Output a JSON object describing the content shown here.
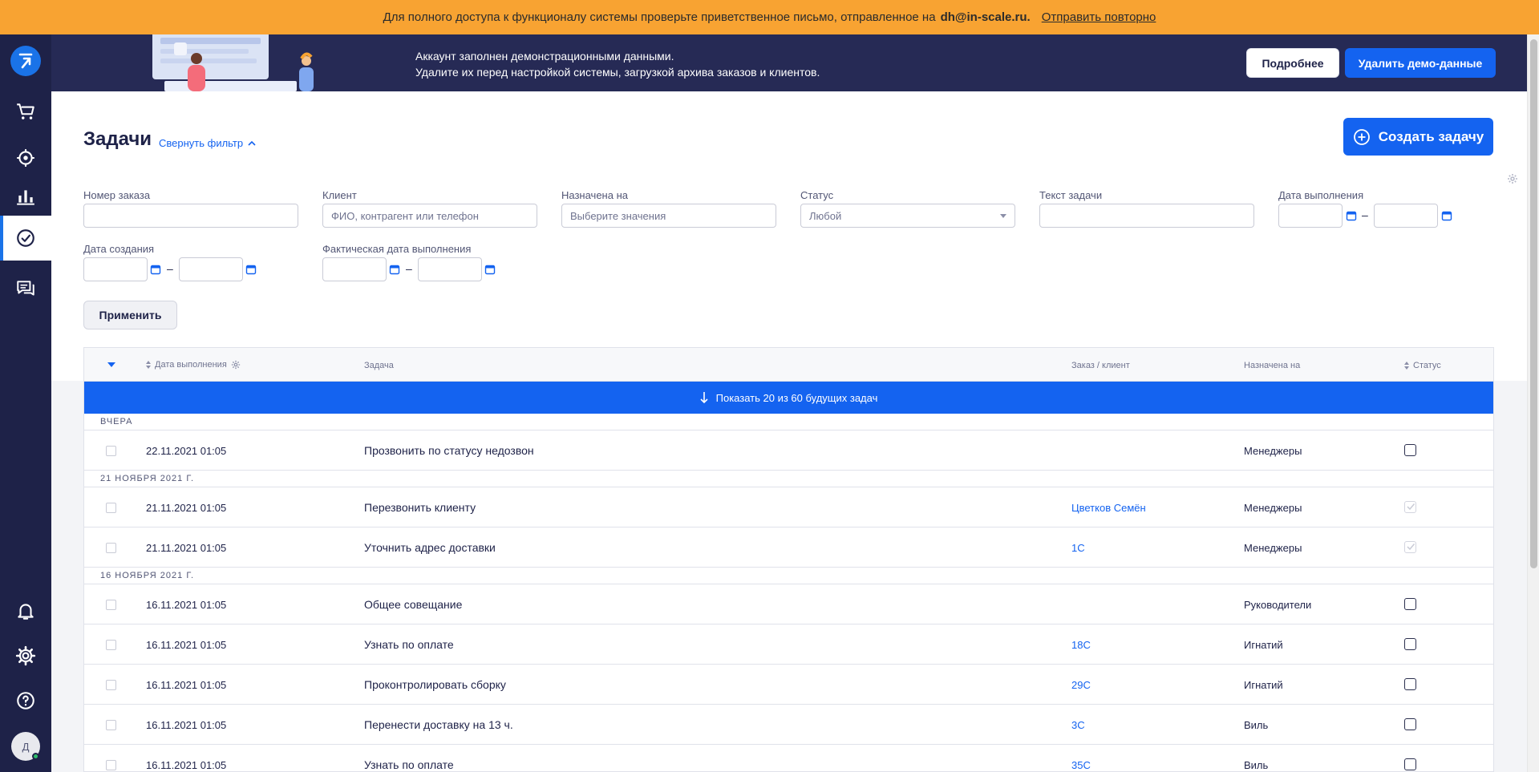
{
  "notice": {
    "text": "Для полного доступа к функционалу системы проверьте приветственное письмо, отправленное на",
    "email": "dh@in-scale.ru.",
    "resend": "Отправить повторно"
  },
  "sidebar": {
    "avatar_initial": "Д",
    "items": [
      "cart",
      "location",
      "analytics",
      "tasks",
      "chats",
      "notifications",
      "settings",
      "help"
    ]
  },
  "demo": {
    "line1": "Аккаунт заполнен демонстрационными данными.",
    "line2": "Удалите их перед настройкой системы, загрузкой архива заказов и клиентов.",
    "more_label": "Подробнее",
    "delete_label": "Удалить демо-данные"
  },
  "page": {
    "title": "Задачи",
    "collapse_filter": "Свернуть фильтр",
    "create_label": "Создать задачу"
  },
  "filters": {
    "order_number": {
      "label": "Номер заказа",
      "value": ""
    },
    "client": {
      "label": "Клиент",
      "placeholder": "ФИО, контрагент или телефон"
    },
    "assigned": {
      "label": "Назначена на",
      "placeholder": "Выберите значения"
    },
    "status": {
      "label": "Статус",
      "value": "Любой"
    },
    "task_text": {
      "label": "Текст задачи",
      "value": ""
    },
    "due_date": {
      "label": "Дата выполнения"
    },
    "created_date": {
      "label": "Дата создания"
    },
    "actual_date": {
      "label": "Фактическая дата выполнения"
    },
    "dash": "–",
    "apply_label": "Применить"
  },
  "table": {
    "headers": {
      "due_date": "Дата выполнения",
      "task": "Задача",
      "order_client": "Заказ / клиент",
      "assigned": "Назначена на",
      "status": "Статус"
    },
    "show_more": "Показать 20 из 60 будущих задач",
    "groups": [
      {
        "label": "ВЧЕРА"
      },
      {
        "label": "21 НОЯБРЯ 2021 Г."
      },
      {
        "label": "16 НОЯБРЯ 2021 Г."
      }
    ],
    "rows": [
      {
        "date": "22.11.2021 01:05",
        "task": "Прозвонить по статусу недозвон",
        "order": "",
        "assigned": "Менеджеры",
        "done": false
      },
      {
        "date": "21.11.2021 01:05",
        "task": "Перезвонить клиенту",
        "order": "Цветков Семён",
        "assigned": "Менеджеры",
        "done": true
      },
      {
        "date": "21.11.2021 01:05",
        "task": "Уточнить адрес доставки",
        "order": "1C",
        "assigned": "Менеджеры",
        "done": true
      },
      {
        "date": "16.11.2021 01:05",
        "task": "Общее совещание",
        "order": "",
        "assigned": "Руководители",
        "done": false
      },
      {
        "date": "16.11.2021 01:05",
        "task": "Узнать по оплате",
        "order": "18C",
        "assigned": "Игнатий",
        "done": false
      },
      {
        "date": "16.11.2021 01:05",
        "task": "Проконтролировать сборку",
        "order": "29C",
        "assigned": "Игнатий",
        "done": false
      },
      {
        "date": "16.11.2021 01:05",
        "task": "Перенести доставку на 13 ч.",
        "order": "3C",
        "assigned": "Виль",
        "done": false
      },
      {
        "date": "16.11.2021 01:05",
        "task": "Узнать по оплате",
        "order": "35C",
        "assigned": "Виль",
        "done": false
      }
    ]
  },
  "colors": {
    "accent": "#1463f0",
    "sidebar": "#1e2248",
    "notice": "#f8a332",
    "banner": "#262a55"
  }
}
